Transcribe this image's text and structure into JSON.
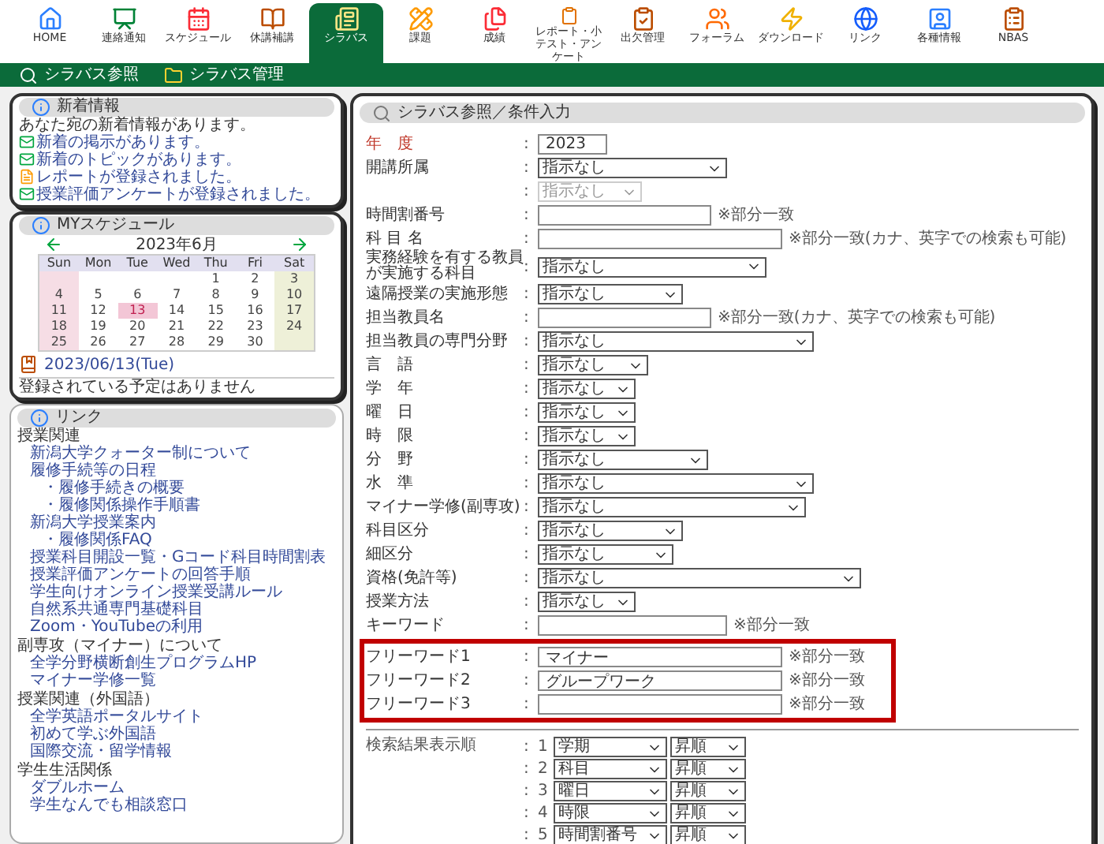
{
  "nav": {
    "items": [
      {
        "label": "HOME",
        "selected": false
      },
      {
        "label": "連絡通知",
        "selected": false
      },
      {
        "label": "スケジュール",
        "selected": false
      },
      {
        "label": "休講補講",
        "selected": false
      },
      {
        "label": "シラバス",
        "selected": true
      },
      {
        "label": "課題",
        "selected": false
      },
      {
        "label": "成績",
        "selected": false
      },
      {
        "label": "レポート・小テスト・アンケート",
        "selected": false
      },
      {
        "label": "出欠管理",
        "selected": false
      },
      {
        "label": "フォーラム",
        "selected": false
      },
      {
        "label": "ダウンロード",
        "selected": false
      },
      {
        "label": "リンク",
        "selected": false
      },
      {
        "label": "各種情報",
        "selected": false
      },
      {
        "label": "NBAS",
        "selected": false
      }
    ]
  },
  "subnav": [
    {
      "label": "シラバス参照",
      "kind": "search"
    },
    {
      "label": "シラバス管理",
      "kind": "folder"
    }
  ],
  "news": {
    "title": "新着情報",
    "intro": "あなた宛の新着情報があります。",
    "items": [
      {
        "text": "新着の掲示があります。",
        "kind": "board"
      },
      {
        "text": "新着のトピックがあります。",
        "kind": "board"
      },
      {
        "text": "レポートが登録されました。",
        "kind": "report"
      },
      {
        "text": "授業評価アンケートが登録されました。",
        "kind": "board"
      }
    ]
  },
  "schedule": {
    "title": "MYスケジュール",
    "month": "2023年6月",
    "weekdays": [
      "Sun",
      "Mon",
      "Tue",
      "Wed",
      "Thu",
      "Fri",
      "Sat"
    ],
    "weeks": [
      [
        {
          "kind": "blank"
        },
        {
          "kind": "blank"
        },
        {
          "kind": "blank"
        },
        {
          "kind": "blank"
        },
        {
          "kind": "day",
          "day": "1",
          "selected": false
        },
        {
          "kind": "day",
          "day": "2",
          "selected": false
        },
        {
          "kind": "day",
          "day": "3",
          "selected": false
        }
      ],
      [
        {
          "kind": "day",
          "day": "4",
          "selected": false
        },
        {
          "kind": "day",
          "day": "5",
          "selected": false
        },
        {
          "kind": "day",
          "day": "6",
          "selected": false
        },
        {
          "kind": "day",
          "day": "7",
          "selected": false
        },
        {
          "kind": "day",
          "day": "8",
          "selected": false
        },
        {
          "kind": "day",
          "day": "9",
          "selected": false
        },
        {
          "kind": "day",
          "day": "10",
          "selected": false
        }
      ],
      [
        {
          "kind": "day",
          "day": "11",
          "selected": false
        },
        {
          "kind": "day",
          "day": "12",
          "selected": false
        },
        {
          "kind": "day",
          "day": "13",
          "selected": true
        },
        {
          "kind": "day",
          "day": "14",
          "selected": false
        },
        {
          "kind": "day",
          "day": "15",
          "selected": false
        },
        {
          "kind": "day",
          "day": "16",
          "selected": false
        },
        {
          "kind": "day",
          "day": "17",
          "selected": false
        }
      ],
      [
        {
          "kind": "day",
          "day": "18",
          "selected": false
        },
        {
          "kind": "day",
          "day": "19",
          "selected": false
        },
        {
          "kind": "day",
          "day": "20",
          "selected": false
        },
        {
          "kind": "day",
          "day": "21",
          "selected": false
        },
        {
          "kind": "day",
          "day": "22",
          "selected": false
        },
        {
          "kind": "day",
          "day": "23",
          "selected": false
        },
        {
          "kind": "day",
          "day": "24",
          "selected": false
        }
      ],
      [
        {
          "kind": "day",
          "day": "25",
          "selected": false
        },
        {
          "kind": "day",
          "day": "26",
          "selected": false
        },
        {
          "kind": "day",
          "day": "27",
          "selected": false
        },
        {
          "kind": "day",
          "day": "28",
          "selected": false
        },
        {
          "kind": "day",
          "day": "29",
          "selected": false
        },
        {
          "kind": "day",
          "day": "30",
          "selected": false
        },
        {
          "kind": "blank"
        }
      ]
    ],
    "date": "2023/06/13(Tue)",
    "empty": "登録されている予定はありません"
  },
  "links": {
    "title": "リンク",
    "groups": [
      {
        "heading": "授業関連",
        "items": [
          {
            "text": "新潟大学クォーター制について"
          },
          {
            "text": "履修手続等の日程",
            "children": [
              {
                "text": "・履修手続きの概要"
              },
              {
                "text": "・履修関係操作手順書"
              }
            ]
          },
          {
            "text": "新潟大学授業案内",
            "children": [
              {
                "text": "・履修関係FAQ"
              }
            ]
          },
          {
            "text": "授業科目開設一覧・Gコード科目時間割表"
          },
          {
            "text": "授業評価アンケートの回答手順"
          },
          {
            "text": "学生向けオンライン授業受講ルール"
          },
          {
            "text": "自然系共通専門基礎科目"
          },
          {
            "text": "Zoom・YouTubeの利用"
          }
        ]
      },
      {
        "heading": "副専攻（マイナー）について",
        "items": [
          {
            "text": "全学分野横断創生プログラムHP"
          },
          {
            "text": "マイナー学修一覧"
          }
        ]
      },
      {
        "heading": "授業関連（外国語）",
        "items": [
          {
            "text": "全学英語ポータルサイト"
          },
          {
            "text": "初めて学ぶ外国語"
          },
          {
            "text": "国際交流・留学情報"
          }
        ]
      },
      {
        "heading": "学生生活関係",
        "items": [
          {
            "text": "ダブルホーム"
          },
          {
            "text": "学生なんでも相談窓口"
          }
        ]
      }
    ]
  },
  "form": {
    "title": "シラバス参照／条件入力",
    "sections": [
      {
        "highlighted": false,
        "fields": [
          {
            "label": "年　度",
            "colon": ":",
            "kind": "text",
            "value": "2023",
            "emphasis": true
          },
          {
            "label": "開講所属",
            "colon": ":",
            "kind": "select",
            "value": "指示なし"
          },
          {
            "colon": ":",
            "kind": "select",
            "value": "指示なし",
            "disabled": true
          },
          {
            "label": "時間割番号",
            "colon": ":",
            "kind": "text",
            "note": "※部分一致"
          },
          {
            "label": "科 目 名",
            "colon": ":",
            "kind": "text",
            "note": "※部分一致(カナ、英字での検索も可能)"
          },
          {
            "label": "実務経験を有する教員が実施する科目",
            "colon": ":",
            "kind": "select",
            "value": "指示なし"
          },
          {
            "label": "遠隔授業の実施形態",
            "colon": ":",
            "kind": "select",
            "value": "指示なし"
          },
          {
            "label": "担当教員名",
            "colon": ":",
            "kind": "text",
            "note": "※部分一致(カナ、英字での検索も可能)"
          },
          {
            "label": "担当教員の専門分野",
            "colon": ":",
            "kind": "select",
            "value": "指示なし"
          },
          {
            "label": "言　語",
            "colon": ":",
            "kind": "select",
            "value": "指示なし"
          },
          {
            "label": "学　年",
            "colon": ":",
            "kind": "select",
            "value": "指示なし"
          },
          {
            "label": "曜　日",
            "colon": ":",
            "kind": "select",
            "value": "指示なし"
          },
          {
            "label": "時　限",
            "colon": ":",
            "kind": "select",
            "value": "指示なし"
          },
          {
            "label": "分　野",
            "colon": ":",
            "kind": "select",
            "value": "指示なし"
          },
          {
            "label": "水　準",
            "colon": ":",
            "kind": "select",
            "value": "指示なし"
          },
          {
            "label": "マイナー学修(副専攻)",
            "colon": ":",
            "kind": "select",
            "value": "指示なし"
          },
          {
            "label": "科目区分",
            "colon": ":",
            "kind": "select",
            "value": "指示なし"
          },
          {
            "label": "細区分",
            "colon": ":",
            "kind": "select",
            "value": "指示なし"
          },
          {
            "label": "資格(免許等)",
            "colon": ":",
            "kind": "select",
            "value": "指示なし"
          },
          {
            "label": "授業方法",
            "colon": ":",
            "kind": "select",
            "value": "指示なし"
          },
          {
            "label": "キーワード",
            "colon": ":",
            "kind": "text",
            "note": "※部分一致"
          }
        ]
      },
      {
        "highlighted": true,
        "fields": [
          {
            "label": "フリーワード1",
            "colon": ":",
            "kind": "text",
            "value": "マイナー",
            "note": "※部分一致"
          },
          {
            "label": "フリーワード2",
            "colon": ":",
            "kind": "text",
            "value": "グループワーク",
            "note": "※部分一致"
          },
          {
            "label": "フリーワード3",
            "colon": ":",
            "kind": "text",
            "note": "※部分一致"
          }
        ]
      }
    ],
    "sort": {
      "label": "検索結果表示順",
      "rows": [
        {
          "colon": ":",
          "index": "1",
          "key": "学期",
          "order": "昇順"
        },
        {
          "colon": ":",
          "index": "2",
          "key": "科目",
          "order": "昇順"
        },
        {
          "colon": ":",
          "index": "3",
          "key": "曜日",
          "order": "昇順"
        },
        {
          "colon": ":",
          "index": "4",
          "key": "時限",
          "order": "昇順"
        },
        {
          "colon": ":",
          "index": "5",
          "key": "時間割番号",
          "order": "昇順"
        }
      ]
    }
  }
}
